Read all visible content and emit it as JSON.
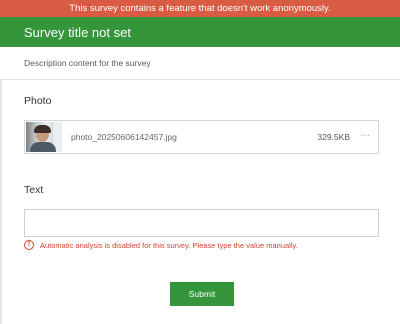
{
  "banner": {
    "text": "This survey contains a feature that doesn't work anonymously."
  },
  "header": {
    "title": "Survey title not set"
  },
  "description": {
    "text": "Description content for the survey"
  },
  "photo_question": {
    "label": "Photo",
    "attachment": {
      "file_name": "photo_20250606142457.jpg",
      "file_size": "329.5KB",
      "more_icon": "···"
    }
  },
  "text_question": {
    "label": "Text",
    "value": "",
    "error": {
      "icon": "!",
      "message": "Automatic analysis is disabled for this survey. Please type the value manually."
    }
  },
  "submit": {
    "label": "Submit"
  },
  "colors": {
    "banner": "#d95b43",
    "header": "#35953b",
    "error": "#d0442f",
    "button": "#35953b"
  }
}
